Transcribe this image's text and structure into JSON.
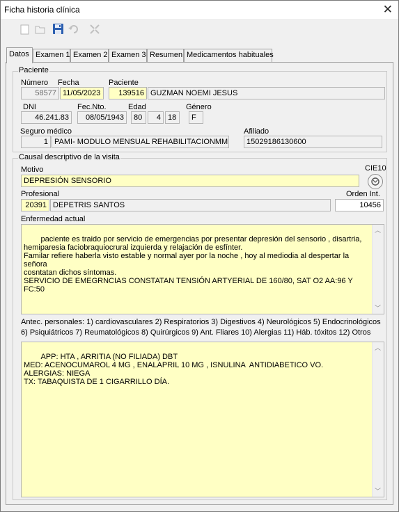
{
  "window": {
    "title": "Ficha historia clínica",
    "close_glyph": "✕"
  },
  "toolbar": {
    "icons": [
      "new-icon",
      "open-icon",
      "save-icon",
      "undo-icon",
      "expand-icon"
    ]
  },
  "tabs": [
    "Datos",
    "Examen 1",
    "Examen 2",
    "Examen 3",
    "Resumen",
    "Medicamentos habituales"
  ],
  "paciente": {
    "group_title": "Paciente",
    "numero_label": "Número",
    "numero": "58577",
    "fecha_label": "Fecha",
    "fecha": "11/05/2023",
    "paciente_label": "Paciente",
    "paciente_id": "139516",
    "paciente_nombre": "GUZMAN NOEMI JESUS",
    "dni_label": "DNI",
    "dni": "46.241.83",
    "fecnto_label": "Fec.Nto.",
    "fecnto": "08/05/1943",
    "edad_label": "Edad",
    "edad_anios": "80",
    "edad_meses": "4",
    "edad_dias": "18",
    "genero_label": "Género",
    "genero": "F",
    "seguro_label": "Seguro médico",
    "seguro_id": "1",
    "seguro_nombre": "PAMI- MODULO MENSUAL REHABILITACIONMMF",
    "afiliado_label": "Afiliado",
    "afiliado": "15029186130600"
  },
  "causal": {
    "group_title": "Causal descriptivo de la visita",
    "motivo_label": "Motivo",
    "motivo": "DEPRESIÓN SENSORIO",
    "cie10_label": "CIE10",
    "profesional_label": "Profesional",
    "profesional_id": "20391",
    "profesional_nombre": "DEPETRIS SANTOS",
    "orden_label": "Orden Int.",
    "orden": "10456",
    "enfermedad_label": "Enfermedad actual",
    "enfermedad": "paciente es traido por servicio de emergencias por presentar depresión del sensorio , disartria,\nhemiparesia faciobraquiocrural izquierda y relajación de esfínter.\nFamilar refiere haberla visto estable y normal ayer por la noche , hoy al mediodia al despertar la señora\ncosntatan dichos síntomas.\nSERVICIO DE EMEGRNCIAS CONSTATAN TENSIÓN ARTYERIAL DE 160/80, SAT O2 AA:96 Y\nFC:50",
    "antec_line1": "Antec. personales: 1) cardiovasculares 2) Respiratorios 3) Digestivos 4) Neurológicos  5) Endocrinológicos",
    "antec_line2": "6) Psiquiátricos 7) Reumatológicos 8) Quirúrgicos 9) Ant. Fliares 10) Alergias 11) Háb. tóxitos 12) Otros",
    "antecedentes": "APP: HTA , ARRITIA (NO FILIADA) DBT\nMED: ACENOCUMAROL 4 MG , ENALAPRIL 10 MG , ISNULINA  ANTIDIABETICO VO.\nALERGIAS: NIEGA\nTX: TABAQUISTA DE 1 CIGARRILLO DÍA."
  }
}
